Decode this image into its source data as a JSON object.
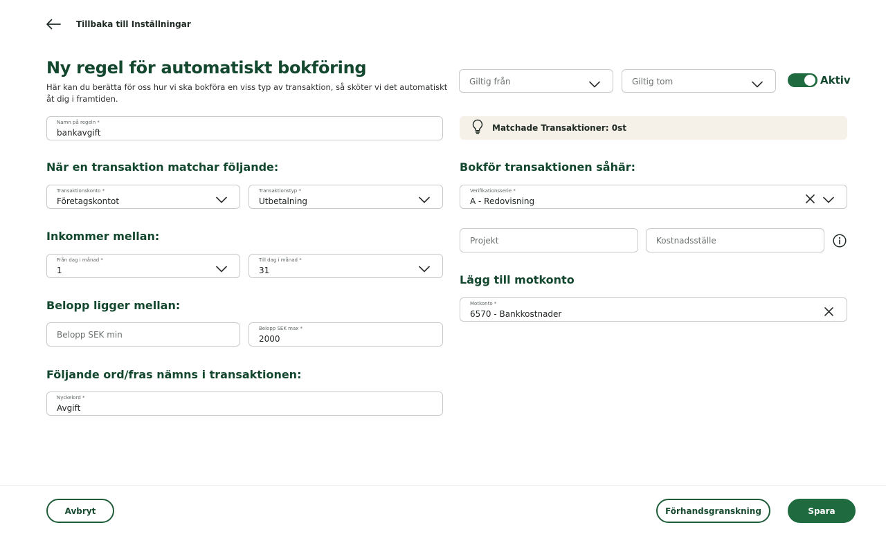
{
  "back": {
    "label": "Tillbaka till Inställningar",
    "icon": "arrow-left-icon"
  },
  "header": {
    "title": "Ny regel för automatiskt bokföring",
    "description": "Här kan du berätta för oss hur vi ska bokföra en viss typ av transaktion, så sköter vi det automatiskt åt dig i framtiden."
  },
  "rule_name": {
    "label": "Namn på regeln *",
    "value": "bankavgift"
  },
  "validity": {
    "from_placeholder": "Giltig från",
    "to_placeholder": "Giltig tom",
    "active_label": "Aktiv",
    "active": true
  },
  "match_info": {
    "text": "Matchade Transaktioner: 0st",
    "icon": "lightbulb-icon"
  },
  "sections": {
    "match": "När en transaktion matchar följande:",
    "incoming": "Inkommer mellan:",
    "amount": "Belopp ligger mellan:",
    "keywords": "Följande ord/fras nämns i transaktionen:",
    "booking": "Bokför transaktionen såhär:",
    "counter": "Lägg till motkonto"
  },
  "transaction_account": {
    "label": "Transaktionskonto *",
    "value": "Företagskontot"
  },
  "transaction_type": {
    "label": "Transaktionstyp *",
    "value": "Utbetalning"
  },
  "day_from": {
    "label": "Från dag i månad *",
    "value": "1"
  },
  "day_to": {
    "label": "Till dag i månad *",
    "value": "31"
  },
  "amount_min": {
    "placeholder": "Belopp SEK min"
  },
  "amount_max": {
    "label": "Belopp SEK max *",
    "value": "2000"
  },
  "keyword": {
    "label": "Nyckelord *",
    "value": "Avgift"
  },
  "voucher_series": {
    "label": "Verifikationsserie *",
    "value": "A - Redovisning"
  },
  "project": {
    "placeholder": "Projekt"
  },
  "cost_center": {
    "placeholder": "Kostnadsställe"
  },
  "counter_account": {
    "label": "Motkonto *",
    "value": "6570 - Bankkostnader"
  },
  "footer": {
    "cancel": "Avbryt",
    "preview": "Förhandsgranskning",
    "save": "Spara"
  },
  "colors": {
    "primary": "#1f6b3f",
    "heading": "#13472e",
    "info_bg": "#f5f0e8"
  }
}
